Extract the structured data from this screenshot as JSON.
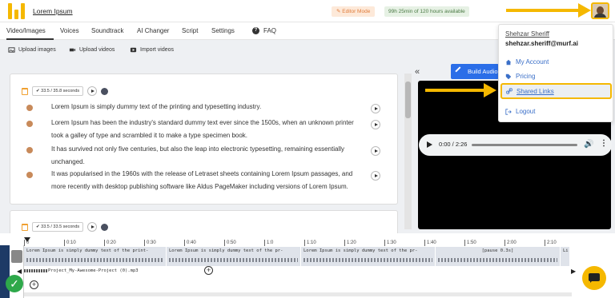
{
  "header": {
    "project_title": "Lorem Ipsum",
    "editor_mode": "Editor Mode",
    "hours_available": "99h 25min of 120 hours available"
  },
  "tabs": [
    "Video/Images",
    "Voices",
    "Soundtrack",
    "AI Changer",
    "Script",
    "Settings",
    "FAQ"
  ],
  "subtoolbar": {
    "upload_images": "Upload images",
    "upload_videos": "Upload videos",
    "import_videos": "Import videos"
  },
  "script": {
    "block1": {
      "duration": "33.5 / 35.8 seconds",
      "paragraphs": [
        "Lorem Ipsum is simply dummy text of the printing and typesetting industry.",
        "Lorem Ipsum has been the industry's standard dummy text ever since the 1500s, when an unknown printer took a galley of type and scrambled it to make a type specimen book.",
        "It has survived not only five centuries, but also the leap into electronic typesetting, remaining essentially unchanged.",
        "It was popularised in the 1960s with the release of Letraset sheets containing Lorem Ipsum passages, and more recently with desktop publishing software like Aldus PageMaker including versions of Lorem Ipsum."
      ]
    },
    "block2": {
      "duration": "33.5 / 33.5 seconds"
    }
  },
  "preview": {
    "build_audio": "Build Audio",
    "collapse_icon": "«",
    "time": "0:00 / 2:26"
  },
  "account_menu": {
    "name": "Shehzar Sheriff",
    "email": "shehzar.sheriff@murf.ai",
    "items": [
      "My Account",
      "Pricing",
      "Shared Links",
      "Logout"
    ],
    "highlighted": "Shared Links"
  },
  "timeline": {
    "ticks": [
      "0",
      "0:10",
      "0:20",
      "0:30",
      "0:40",
      "0:50",
      "1:0",
      "1:10",
      "1:20",
      "1:30",
      "1:40",
      "1:50",
      "2:00",
      "2:10"
    ],
    "segments": [
      "Lorem Ipsum is simply dummy text of the print-",
      "Lorem Ipsum is simply dummy text of the pr-",
      "Lorem Ipsum is simply dummy text of the pr-",
      "[pause 0.3s]",
      "Li"
    ],
    "music_track": "Project_My-Awesome-Project (0).mp3"
  },
  "colors": {
    "accent": "#f5b800",
    "primary_button": "#2b6ee8",
    "link": "#3a6fc8",
    "timeline_sidebar": "#1d3a66",
    "success": "#2ea84a"
  }
}
